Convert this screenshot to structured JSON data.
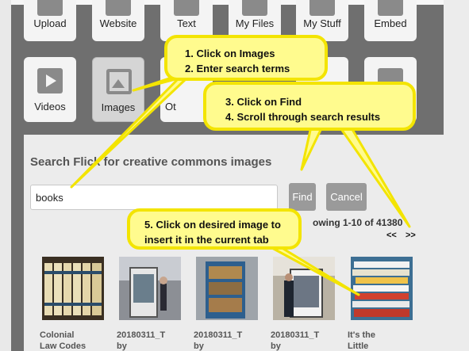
{
  "tiles": {
    "upload": "Upload",
    "website": "Website",
    "text": "Text",
    "my_files": "My Files",
    "my_stuff": "My Stuff",
    "embed": "Embed",
    "videos": "Videos",
    "images": "Images",
    "other_partial": "Ot"
  },
  "search": {
    "title": "Search Flick    for creative commons images",
    "query": "books",
    "find_label": "Find",
    "cancel_label": "Cancel",
    "showing": "owing 1-10 of 41380",
    "prev": "<<",
    "next": ">>"
  },
  "results": [
    {
      "title_line1": "Colonial",
      "title_line2": "Law Codes"
    },
    {
      "title_line1": "20180311_T",
      "title_line2": "by"
    },
    {
      "title_line1": "20180311_T",
      "title_line2": "by"
    },
    {
      "title_line1": "20180311_T",
      "title_line2": "by"
    },
    {
      "title_line1": "It's the",
      "title_line2": "Little"
    }
  ],
  "callouts": {
    "c1_line1": "1. Click on Images",
    "c1_line2": "2. Enter search terms",
    "c2_line1": "3. Click on Find",
    "c2_line2": "4. Scroll through search results",
    "c3_line1": "5. Click on desired image to",
    "c3_line2": "insert it in the current tab"
  },
  "colors": {
    "callout_fill": "#fffb8e",
    "callout_border": "#f3e400",
    "button": "#9a9a9a"
  }
}
